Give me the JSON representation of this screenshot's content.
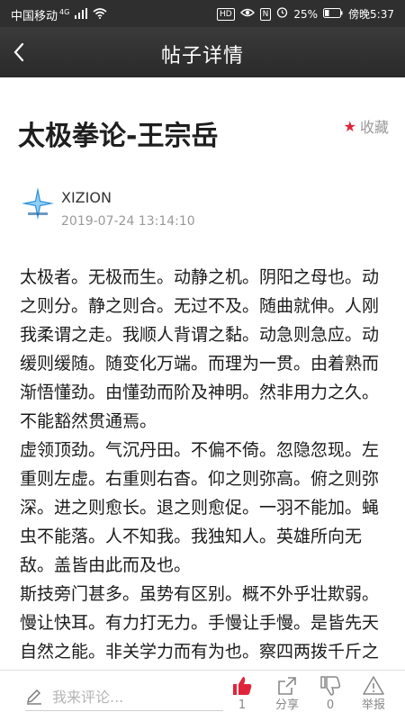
{
  "status_bar": {
    "carrier": "中国移动",
    "network": "4G",
    "hd_label": "HD",
    "nfc_label": "N",
    "battery": "25%",
    "time": "傍晚5:37"
  },
  "nav": {
    "title": "帖子详情",
    "back_icon": "chevron-left-icon"
  },
  "post": {
    "title": "太极拳论-王宗岳",
    "favorite_label": "收藏",
    "author": "XIZION",
    "date": "2019-07-24 13:14:10",
    "paragraphs": [
      "太极者。无极而生。动静之机。阴阳之母也。动之则分。静之则合。无过不及。随曲就伸。人刚我柔谓之走。我顺人背谓之黏。动急则急应。动缓则缓随。随变化万端。而理为一贯。由着熟而渐悟懂劲。由懂劲而阶及神明。然非用力之久。不能豁然贯通焉。",
      "虚领顶劲。气沉丹田。不偏不倚。忽隐忽现。左重则左虚。右重则右杳。仰之则弥高。俯之则弥深。进之则愈长。退之则愈促。一羽不能加。蝇虫不能落。人不知我。我独知人。英雄所向无敌。盖皆由此而及也。",
      "斯技旁门甚多。虽势有区别。概不外乎壮欺弱。慢让快耳。有力打无力。手慢让手慢。是皆先天自然之能。非关学力而有为也。察四两拨千斤之句。显非力胜。观耄耋能御众之形。"
    ]
  },
  "bottom_bar": {
    "comment_placeholder": "我来评论...",
    "like_count": "1",
    "share_label": "分享",
    "dislike_count": "0",
    "report_label": "举报"
  },
  "colors": {
    "accent_red": "#e0243a",
    "nav_bg": "#2f2f2f"
  }
}
